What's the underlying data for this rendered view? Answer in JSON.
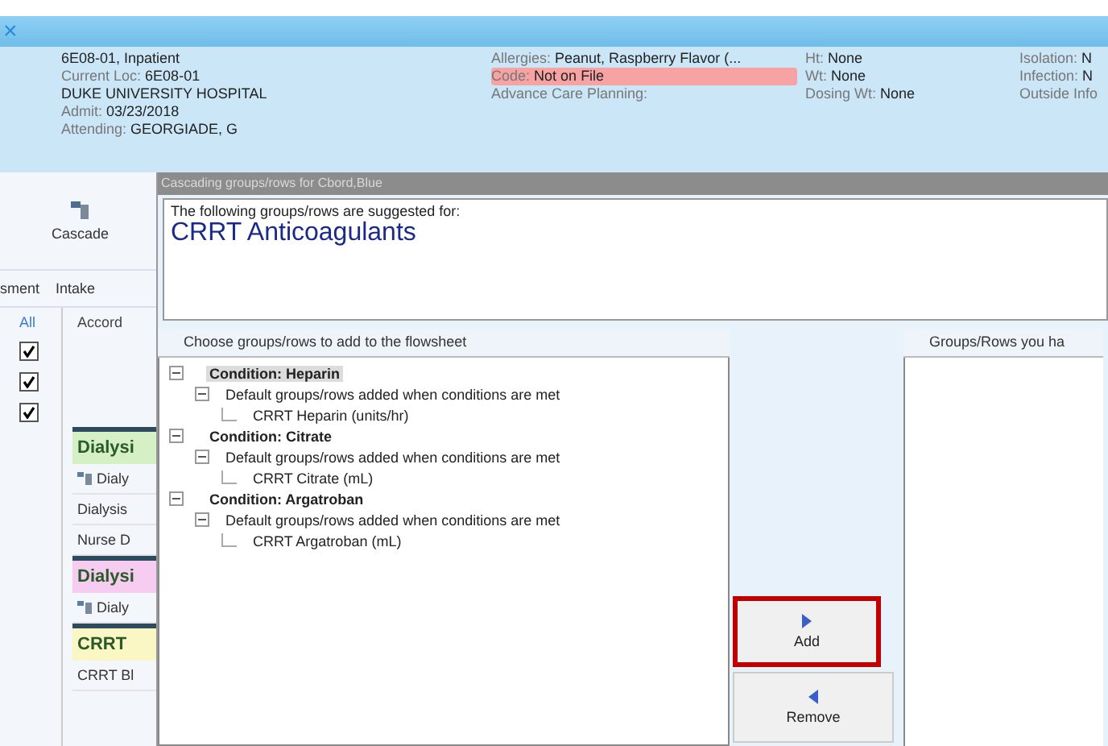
{
  "top_bar": {
    "close": "×"
  },
  "patient_header": {
    "columns": [
      {
        "items": [
          {
            "value": "6E08-01, Inpatient",
            "highlighted": false
          },
          {
            "label": "Current Loc:",
            "value": "6E08-01",
            "highlighted": false
          },
          {
            "value": "DUKE UNIVERSITY HOSPITAL",
            "highlighted": false
          },
          {
            "label": "Admit:",
            "value": "03/23/2018",
            "highlighted": false
          },
          {
            "label": "Attending:",
            "value": "GEORGIADE, G",
            "highlighted": false
          }
        ]
      },
      {
        "items": [
          {
            "label": "Allergies:",
            "value": "Peanut, Raspberry Flavor (...",
            "highlighted": false
          },
          {
            "label": "Code:",
            "value": "Not on File",
            "highlighted": true
          },
          {
            "label": "Advance Care Planning:",
            "highlighted": false
          }
        ]
      },
      {
        "items": [
          {
            "label": "Ht:",
            "value": "None",
            "highlighted": false
          },
          {
            "label": "Wt:",
            "value": "None",
            "highlighted": false
          },
          {
            "label": "Dosing Wt:",
            "value": "None",
            "highlighted": false
          }
        ]
      },
      {
        "items": [
          {
            "label": "Isolation:",
            "value": "N",
            "highlighted": false
          },
          {
            "label": "Infection:",
            "value": "N",
            "highlighted": false
          },
          {
            "label": "Outside Info",
            "highlighted": false
          }
        ]
      }
    ]
  },
  "left_pane": {
    "toolbar_button": "Cascade",
    "tabs": [
      "sment",
      "Intake"
    ],
    "select_all": "All",
    "checkboxes": [
      {
        "checked": true
      },
      {
        "checked": true
      },
      {
        "checked": true
      }
    ],
    "column": "Accord",
    "groups": [
      {
        "kind": "header",
        "label": "Dialysi",
        "color": "#d4f0c4"
      },
      {
        "kind": "row",
        "label": "Dialy",
        "icon": true
      },
      {
        "kind": "row",
        "label": "Dialysis",
        "icon": false
      },
      {
        "kind": "row",
        "label": "Nurse D",
        "icon": false
      },
      {
        "kind": "header",
        "label": "Dialysi",
        "color": "#f6cdf0"
      },
      {
        "kind": "row",
        "label": "Dialy",
        "icon": true
      },
      {
        "kind": "header",
        "label": "CRRT",
        "color": "#fbf7c4"
      },
      {
        "kind": "row",
        "label": "CRRT Bl",
        "icon": false
      }
    ]
  },
  "dialog": {
    "title": "Cascading groups/rows for Cbord,Blue",
    "intro": "The following groups/rows are suggested for:",
    "heading": "CRRT Anticoagulants",
    "left_panel": {
      "title": "Choose groups/rows to add to the flowsheet",
      "tree": [
        {
          "label": "Condition: Heparin",
          "selected": true,
          "expanded": true,
          "children": [
            {
              "label": "Default groups/rows added when conditions are met",
              "selected": false,
              "expanded": true,
              "children": [
                {
                  "label": "CRRT Heparin (units/hr)",
                  "selected": false
                }
              ]
            }
          ]
        },
        {
          "label": "Condition: Citrate",
          "selected": false,
          "expanded": true,
          "children": [
            {
              "label": "Default groups/rows added when conditions are met",
              "selected": false,
              "expanded": true,
              "children": [
                {
                  "label": "CRRT Citrate (mL)",
                  "selected": false
                }
              ]
            }
          ]
        },
        {
          "label": "Condition: Argatroban",
          "selected": false,
          "expanded": true,
          "children": [
            {
              "label": "Default groups/rows added when conditions are met",
              "selected": false,
              "expanded": true,
              "children": [
                {
                  "label": "CRRT Argatroban (mL)",
                  "selected": false
                }
              ]
            }
          ]
        }
      ]
    },
    "buttons": [
      {
        "label": "Add",
        "kind": "forward",
        "highlighted": true
      },
      {
        "label": "Remove",
        "kind": "back",
        "highlighted": false
      }
    ],
    "right_panel": {
      "title": "Groups/Rows you ha"
    }
  }
}
